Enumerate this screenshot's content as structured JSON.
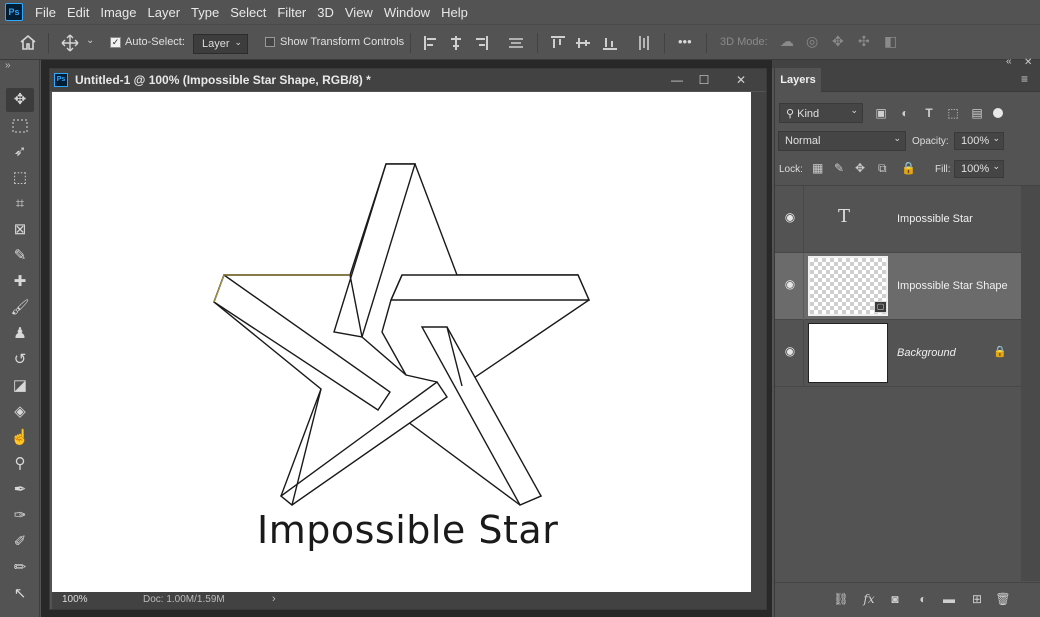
{
  "menu": {
    "items": [
      "File",
      "Edit",
      "Image",
      "Layer",
      "Type",
      "Select",
      "Filter",
      "3D",
      "View",
      "Window",
      "Help"
    ]
  },
  "options_bar": {
    "auto_select_label": "Auto-Select:",
    "auto_select_checked": true,
    "layer_select_value": "Layer",
    "show_transform_label": "Show Transform Controls",
    "show_transform_checked": false,
    "more_label": "•••",
    "mode_3d_label": "3D Mode:"
  },
  "document": {
    "title": "Untitled-1 @ 100% (Impossible Star Shape, RGB/8) *",
    "canvas_text": "Impossible Star",
    "zoom": "100%",
    "doc_info": "Doc: 1.00M/1.59M"
  },
  "layers_panel": {
    "tab_label": "Layers",
    "filter_kind": "Kind",
    "blend_mode": "Normal",
    "opacity_label": "Opacity:",
    "opacity_value": "100%",
    "lock_label": "Lock:",
    "fill_label": "Fill:",
    "fill_value": "100%",
    "layers": [
      {
        "name": "Impossible Star",
        "type": "text",
        "visible": true,
        "selected": false,
        "locked": false
      },
      {
        "name": "Impossible Star Shape",
        "type": "shape",
        "visible": true,
        "selected": true,
        "locked": false
      },
      {
        "name": "Background",
        "type": "background",
        "visible": true,
        "selected": false,
        "locked": true
      }
    ]
  },
  "colors": {
    "ui_bg": "#535353",
    "panel_dark": "#424242",
    "selection": "#6b6b6b",
    "ps_blue": "#31a8ff"
  }
}
